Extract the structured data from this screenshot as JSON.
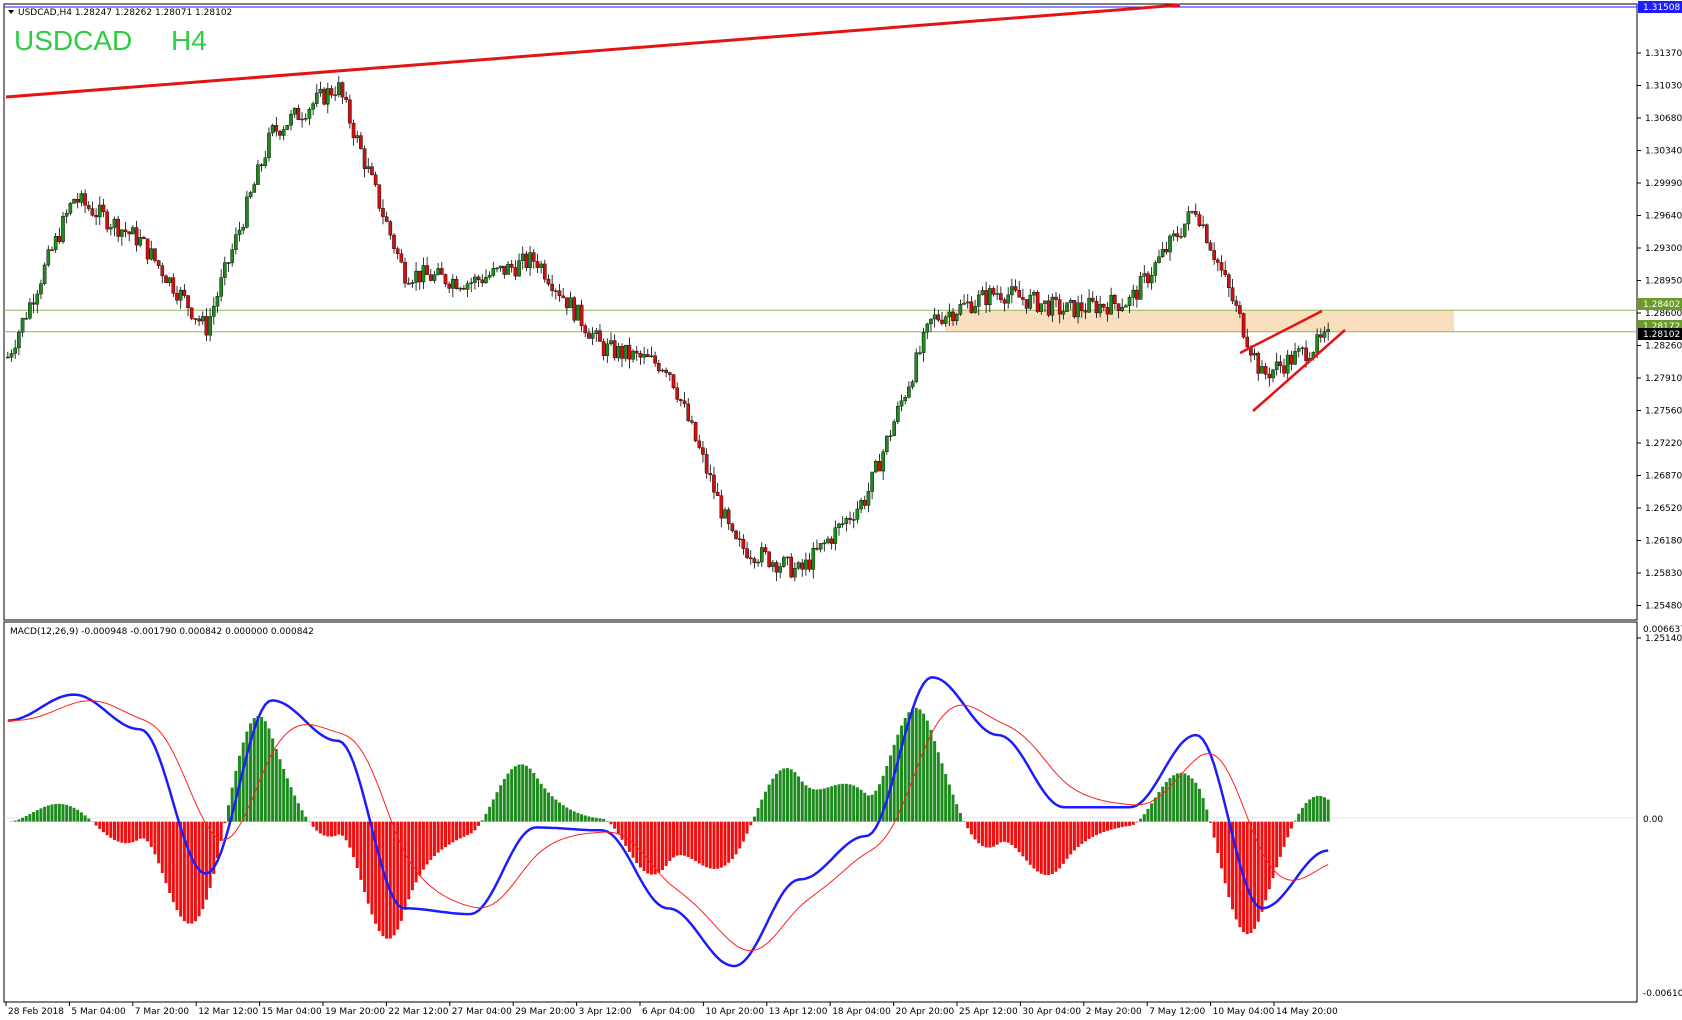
{
  "header": {
    "info_line": "USDCAD,H4  1.28247 1.28262 1.28071 1.28102",
    "symbol_label": "USDCAD",
    "timeframe_label": "H4"
  },
  "colors": {
    "bull": "#1e8a1e",
    "bear": "#d01010",
    "trend": "#e41414",
    "zone": "#f9dfbd",
    "level": "#8db85a",
    "macd_line": "#1c1cff",
    "signal_line": "#ff2020",
    "hist_pos": "#1e8a1e",
    "hist_neg": "#ee1010",
    "tag_bg": "#1c1cff",
    "tag_green": "#6a9a2a"
  },
  "price_axis": {
    "ticks": [
      "1.31370",
      "1.31030",
      "1.30680",
      "1.30340",
      "1.29990",
      "1.29640",
      "1.29300",
      "1.28950",
      "1.28600",
      "1.28260",
      "1.27910",
      "1.27560",
      "1.27220",
      "1.26870",
      "1.26520",
      "1.26180",
      "1.25830",
      "1.25480",
      "1.25140"
    ],
    "tag_top": "1.31508",
    "tag_zone_top": "1.28402",
    "tag_current": "1.28172",
    "tag_current_b": "1.28102"
  },
  "macd": {
    "info_line": "MACD(12,26,9) -0.000948 -0.001790 0.000842 0.000000 0.000842",
    "ticks": [
      "0.006637",
      "0.00",
      "-0.006106"
    ]
  },
  "time_axis": {
    "labels": [
      "28 Feb 2018",
      "5 Mar 04:00",
      "7 Mar 20:00",
      "12 Mar 12:00",
      "15 Mar 04:00",
      "19 Mar 20:00",
      "22 Mar 12:00",
      "27 Mar 04:00",
      "29 Mar 20:00",
      "3 Apr 12:00",
      "6 Apr 04:00",
      "10 Apr 20:00",
      "13 Apr 12:00",
      "18 Apr 04:00",
      "20 Apr 20:00",
      "25 Apr 12:00",
      "30 Apr 04:00",
      "2 May 20:00",
      "7 May 12:00",
      "10 May 04:00",
      "14 May 20:00"
    ]
  },
  "chart_data": {
    "type": "candlestick",
    "symbol": "USDCAD",
    "timeframe": "H4",
    "ylim": [
      1.2514,
      1.3158
    ],
    "close_path": [
      {
        "x": "28 Feb 2018",
        "y": 1.279
      },
      {
        "x": "5 Mar 04:00",
        "y": 1.296
      },
      {
        "x": "7 Mar 20:00",
        "y": 1.2915
      },
      {
        "x": "12 Mar 12:00",
        "y": 1.282
      },
      {
        "x": "15 Mar 04:00",
        "y": 1.303
      },
      {
        "x": "19 Mar 20:00",
        "y": 1.308
      },
      {
        "x": "22 Mar 12:00",
        "y": 1.288
      },
      {
        "x": "27 Mar 04:00",
        "y": 1.287
      },
      {
        "x": "29 Mar 20:00",
        "y": 1.2895
      },
      {
        "x": "3 Apr 12:00",
        "y": 1.28
      },
      {
        "x": "6 Apr 04:00",
        "y": 1.278
      },
      {
        "x": "10 Apr 20:00",
        "y": 1.259
      },
      {
        "x": "13 Apr 12:00",
        "y": 1.256
      },
      {
        "x": "18 Apr 04:00",
        "y": 1.264
      },
      {
        "x": "20 Apr 20:00",
        "y": 1.283
      },
      {
        "x": "25 Apr 12:00",
        "y": 1.286
      },
      {
        "x": "30 Apr 04:00",
        "y": 1.284
      },
      {
        "x": "2 May 20:00",
        "y": 1.285
      },
      {
        "x": "7 May 12:00",
        "y": 1.295
      },
      {
        "x": "10 May 04:00",
        "y": 1.277
      },
      {
        "x": "14 May 20:00",
        "y": 1.281
      }
    ],
    "zone": [
      1.2817,
      1.284
    ],
    "macd": {
      "ylim": [
        -0.006106,
        0.006637
      ],
      "macd_path": [
        0.0035,
        0.0044,
        0.0032,
        -0.0018,
        0.0042,
        0.0028,
        -0.003,
        -0.0032,
        -0.0002,
        -0.0003,
        -0.003,
        -0.005,
        -0.002,
        -0.0005,
        0.005,
        0.003,
        0.0005,
        0.0005,
        0.003,
        -0.003,
        -0.001
      ]
    }
  }
}
